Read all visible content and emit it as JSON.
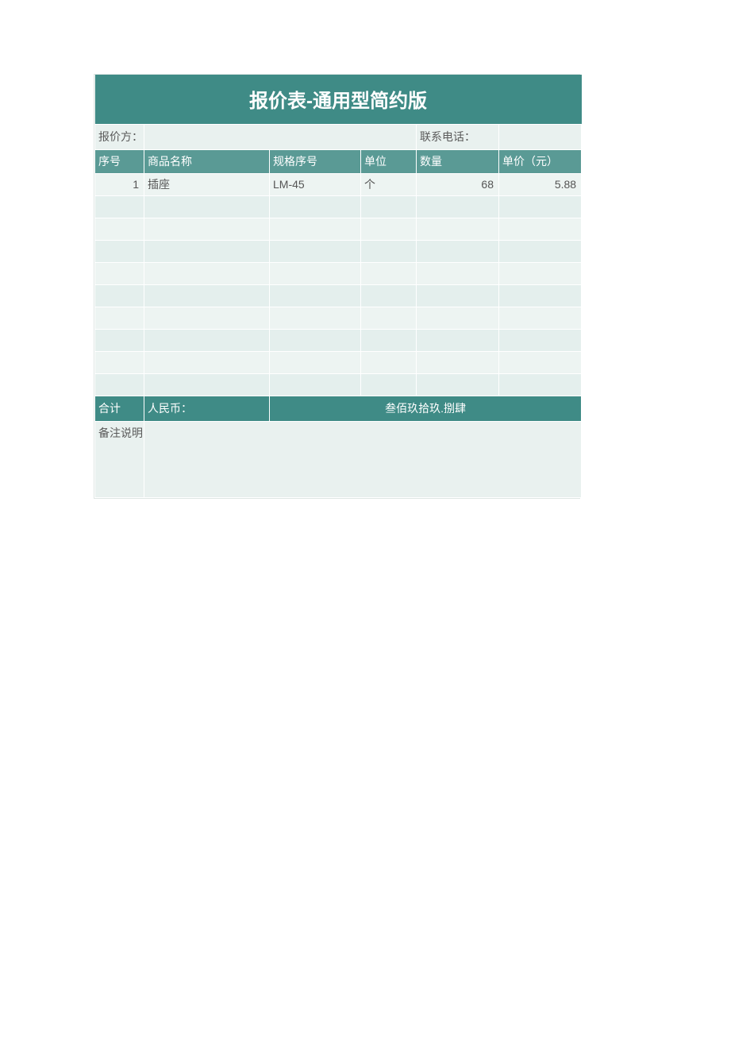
{
  "title": "报价表-通用型简约版",
  "info": {
    "quoter_label": "报价方：",
    "quoter_value": "",
    "phone_label": "联系电话：",
    "phone_value": ""
  },
  "columns": {
    "seq": "序号",
    "name": "商品名称",
    "spec": "规格序号",
    "unit": "单位",
    "qty": "数量",
    "price": "单价（元）"
  },
  "rows": [
    {
      "seq": "1",
      "name": "插座",
      "spec": "LM-45",
      "unit": "个",
      "qty": "68",
      "price": "5.88"
    },
    {
      "seq": "",
      "name": "",
      "spec": "",
      "unit": "",
      "qty": "",
      "price": ""
    },
    {
      "seq": "",
      "name": "",
      "spec": "",
      "unit": "",
      "qty": "",
      "price": ""
    },
    {
      "seq": "",
      "name": "",
      "spec": "",
      "unit": "",
      "qty": "",
      "price": ""
    },
    {
      "seq": "",
      "name": "",
      "spec": "",
      "unit": "",
      "qty": "",
      "price": ""
    },
    {
      "seq": "",
      "name": "",
      "spec": "",
      "unit": "",
      "qty": "",
      "price": ""
    },
    {
      "seq": "",
      "name": "",
      "spec": "",
      "unit": "",
      "qty": "",
      "price": ""
    },
    {
      "seq": "",
      "name": "",
      "spec": "",
      "unit": "",
      "qty": "",
      "price": ""
    },
    {
      "seq": "",
      "name": "",
      "spec": "",
      "unit": "",
      "qty": "",
      "price": ""
    },
    {
      "seq": "",
      "name": "",
      "spec": "",
      "unit": "",
      "qty": "",
      "price": ""
    }
  ],
  "total": {
    "label": "合计",
    "currency_label": "人民币：",
    "amount_cn": "叁佰玖拾玖.捌肆"
  },
  "notes": {
    "label": "备注说明",
    "value": ""
  },
  "colors": {
    "header_dark": "#3f8b86",
    "header_light": "#5a9a95",
    "body_bg": "#e9f1ef"
  }
}
